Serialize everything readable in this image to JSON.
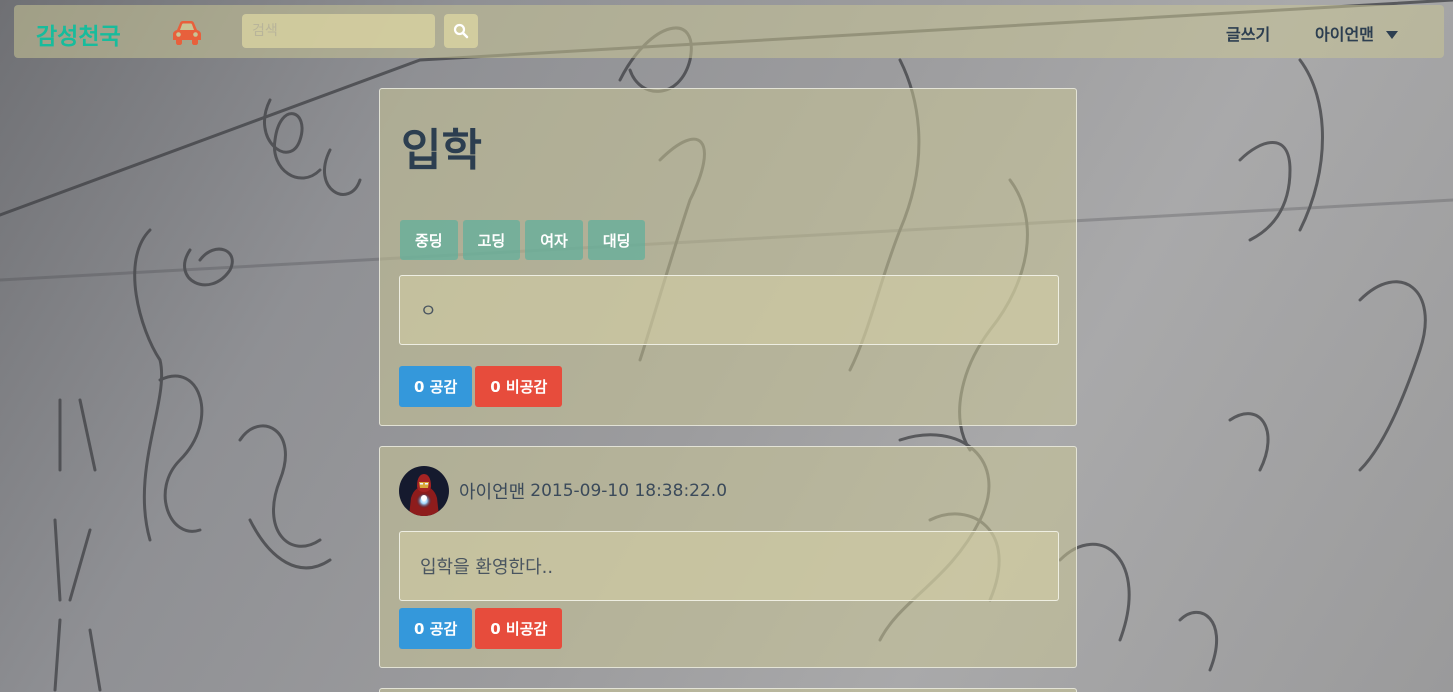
{
  "navbar": {
    "brand": "감성천국",
    "search_placeholder": "검색",
    "write_label": "글쓰기",
    "user_label": "아이언맨"
  },
  "post": {
    "title": "입학",
    "tags": [
      "중딩",
      "고딩",
      "여자",
      "대딩"
    ],
    "content": "ㅇ",
    "like_label": "0 공감",
    "dislike_label": "0 비공감"
  },
  "comments": [
    {
      "author": "아이언맨",
      "timestamp": "2015-09-10 18:38:22.0",
      "content": "입학을 환영한다..",
      "like_label": "0 공감",
      "dislike_label": "0 비공감"
    }
  ],
  "colors": {
    "brand": "#18bc9c",
    "car_icon": "#e8603c",
    "like": "#3498db",
    "dislike": "#e74c3c",
    "tag": "#5cae9b",
    "text": "#2c3e50"
  },
  "icons": {
    "car": "car-icon",
    "search": "search-icon",
    "dropdown": "caret-down-icon"
  }
}
